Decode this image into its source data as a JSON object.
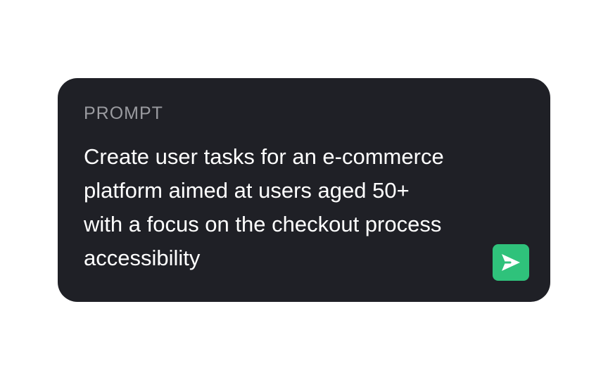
{
  "prompt_card": {
    "label": "PROMPT",
    "text": "Create user tasks for an e-commerce\nplatform aimed at users aged 50+\nwith a focus on the checkout process\naccessibility",
    "send_icon": "send-icon"
  },
  "colors": {
    "card_background": "#1f2026",
    "label_text": "#9a9ba0",
    "prompt_text": "#ffffff",
    "send_button": "#2fc27b"
  }
}
